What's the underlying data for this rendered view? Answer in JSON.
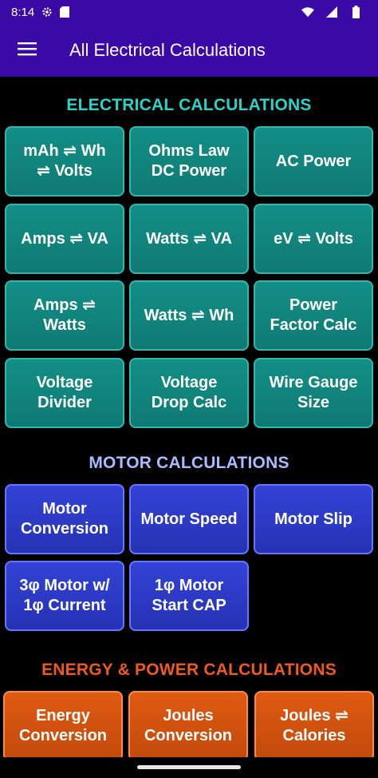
{
  "status": {
    "time": "8:14"
  },
  "appbar": {
    "title": "All Electrical Calculations"
  },
  "colors": {
    "appbar": "#3b0aa6",
    "electrical_heading": "#2ad2c8",
    "motor_heading": "#a9bcff",
    "energy_heading": "#f05a1d",
    "teal_tile": "#138f86",
    "blue_tile": "#2f3ed0",
    "orange_tile": "#d8520f"
  },
  "sections": {
    "electrical": {
      "heading": "ELECTRICAL CALCULATIONS",
      "tiles": [
        "mAh ⇌ Wh\n⇌ Volts",
        "Ohms Law\nDC Power",
        "AC Power",
        "Amps ⇌ VA",
        "Watts ⇌ VA",
        "eV ⇌ Volts",
        "Amps ⇌\nWatts",
        "Watts ⇌ Wh",
        "Power\nFactor Calc",
        "Voltage\nDivider",
        "Voltage\nDrop Calc",
        "Wire Gauge\nSize"
      ]
    },
    "motor": {
      "heading": "MOTOR CALCULATIONS",
      "tiles": [
        "Motor\nConversion",
        "Motor Speed",
        "Motor Slip",
        "3φ Motor w/\n1φ Current",
        "1φ Motor\nStart CAP"
      ]
    },
    "energy": {
      "heading": "ENERGY & POWER CALCULATIONS",
      "tiles": [
        "Energy\nConversion",
        "Joules\nConversion",
        "Joules ⇌\nCalories"
      ]
    }
  }
}
